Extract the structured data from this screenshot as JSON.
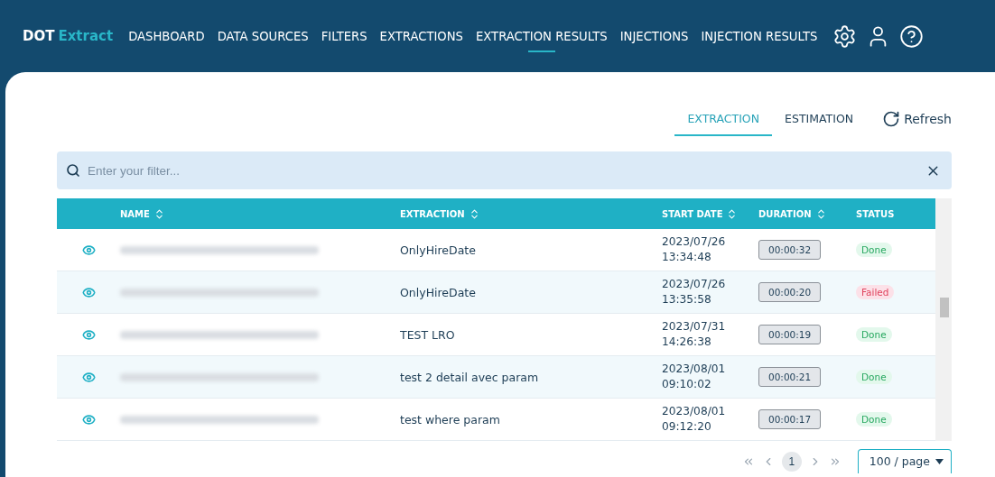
{
  "brand": {
    "first": "DOT",
    "second": "Extract"
  },
  "nav": [
    {
      "label": "DASHBOARD",
      "selected": false
    },
    {
      "label": "DATA SOURCES",
      "selected": false
    },
    {
      "label": "FILTERS",
      "selected": false
    },
    {
      "label": "EXTRACTIONS",
      "selected": false
    },
    {
      "label": "EXTRACTION RESULTS",
      "selected": true
    },
    {
      "label": "INJECTIONS",
      "selected": false
    },
    {
      "label": "INJECTION RESULTS",
      "selected": false
    }
  ],
  "tabs": [
    {
      "label": "EXTRACTION",
      "selected": true
    },
    {
      "label": "ESTIMATION",
      "selected": false
    }
  ],
  "refresh": "Refresh",
  "filter": {
    "placeholder": "Enter your filter..."
  },
  "table": {
    "columns": [
      "NAME",
      "EXTRACTION",
      "START DATE",
      "DURATION",
      "STATUS"
    ],
    "rows": [
      {
        "extraction": "OnlyHireDate",
        "date": "2023/07/26",
        "time": "13:34:48",
        "duration": "00:00:32",
        "status": "Done",
        "kind": "done"
      },
      {
        "extraction": "OnlyHireDate",
        "date": "2023/07/26",
        "time": "13:35:58",
        "duration": "00:00:20",
        "status": "Failed",
        "kind": "failed"
      },
      {
        "extraction": "TEST LRO",
        "date": "2023/07/31",
        "time": "14:26:38",
        "duration": "00:00:19",
        "status": "Done",
        "kind": "done"
      },
      {
        "extraction": "test 2 detail avec param",
        "date": "2023/08/01",
        "time": "09:10:02",
        "duration": "00:00:21",
        "status": "Done",
        "kind": "done"
      },
      {
        "extraction": "test where param",
        "date": "2023/08/01",
        "time": "09:12:20",
        "duration": "00:00:17",
        "status": "Done",
        "kind": "done"
      }
    ]
  },
  "pagination": {
    "pages": [
      {
        "label": "1",
        "selected": true
      }
    ],
    "page_size": "100 / page"
  }
}
